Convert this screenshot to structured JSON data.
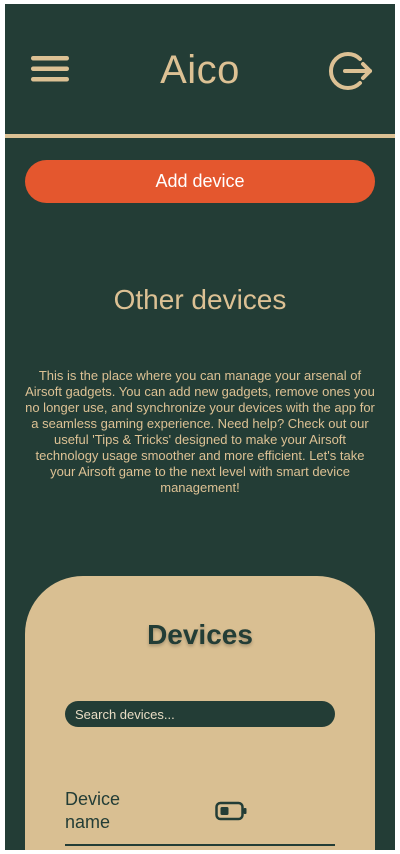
{
  "header": {
    "title": "Aico",
    "menu_icon": "hamburger-menu-icon",
    "logout_icon": "logout-icon"
  },
  "actions": {
    "add_device_label": "Add device"
  },
  "intro": {
    "title": "Other devices",
    "description": "This is the place where you can manage your arsenal of Airsoft gadgets. You can add new gadgets, remove ones you no longer use, and synchronize your devices with the app for a seamless gaming experience. Need help? Check out our useful 'Tips & Tricks' designed to make your Airsoft technology usage smoother and more efficient. Let's take your Airsoft game to the next level with smart device management!"
  },
  "devices": {
    "title": "Devices",
    "search_placeholder": "Search devices...",
    "items": [
      {
        "name": "Device name",
        "status_icon": "battery-icon"
      }
    ]
  },
  "colors": {
    "background": "#233d36",
    "accent": "#dcc194",
    "button": "#e4572e",
    "card": "#d9bf92"
  }
}
